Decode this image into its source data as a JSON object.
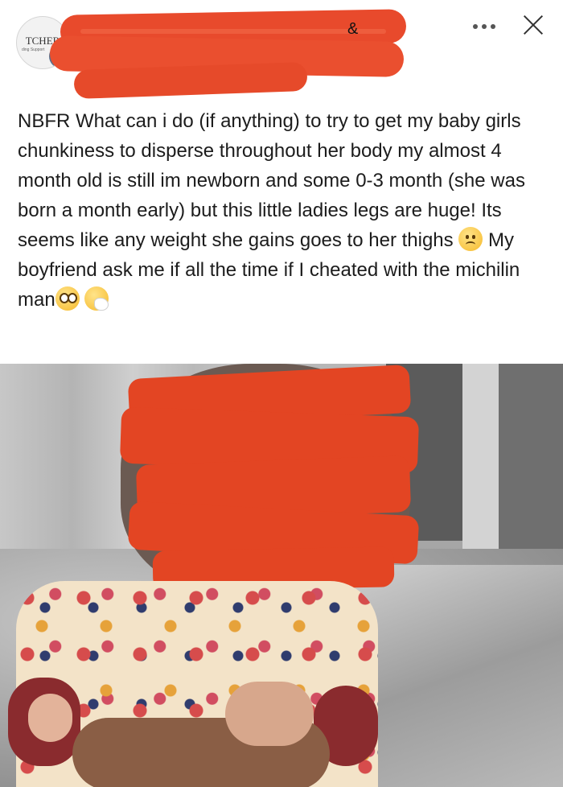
{
  "header": {
    "avatar_text": "TCHER",
    "avatar_subtext": "ding Support",
    "ampersand": "&",
    "more_label": "•••",
    "close_label": "✕"
  },
  "post": {
    "text_before_sad": "NBFR What can i do (if anything) to try to get my baby girls chunkiness to disperse throughout her body my almost 4 month old is still im newborn and some 0-3 month (she was born a month early) but this little ladies legs are huge! Its seems like any weight she gains goes to her thighs",
    "text_after_sad": "My boyfriend ask me if all the time if I cheated with the michilin man",
    "emojis": [
      "sad-face-emoji",
      "pleading-face-emoji",
      "sneezing-face-emoji"
    ]
  },
  "photo": {
    "subject": "baby-photo-redacted"
  },
  "colors": {
    "redaction": "#e84a2c",
    "text": "#1c1c1c",
    "background": "#ffffff"
  }
}
